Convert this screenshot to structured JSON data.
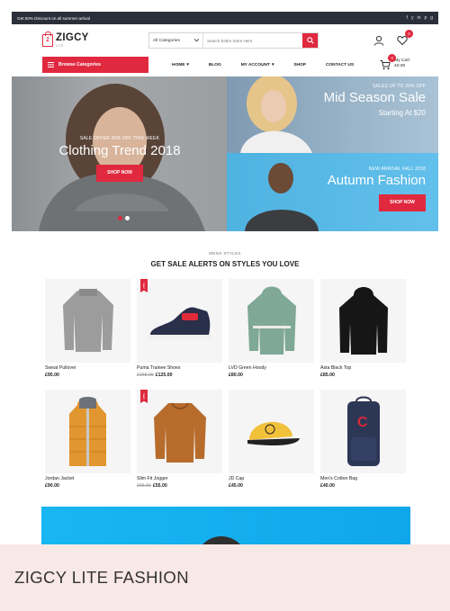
{
  "topbar": {
    "promo": "Get 50% Discount on all summer arrival",
    "social": [
      "f",
      "y",
      "in",
      "p",
      "g"
    ]
  },
  "header": {
    "logo_text": "ZIGCY",
    "logo_sub": "LITE",
    "search_category": "All Categories",
    "search_placeholder": "Search Entire Store Here",
    "wishlist_count": "0"
  },
  "nav": {
    "browse": "Browse Categories",
    "menu": [
      "HOME",
      "BLOG",
      "MY ACCOUNT",
      "SHOP",
      "CONTACT US"
    ],
    "cart_label": "My Cart",
    "cart_total": "£0.00",
    "cart_count": "0"
  },
  "hero": {
    "left": {
      "offer": "SALE OFFER 20% OFF THIS WEEK",
      "title": "Clothing Trend 2018",
      "button": "SHOP NOW"
    },
    "top_right": {
      "offer": "SALES UP TO 25% OFF",
      "title": "Mid Season Sale",
      "sub": "Starting At $20"
    },
    "bottom_right": {
      "offer": "NEW ARRIVAL FALL 2018",
      "title": "Autumn Fashion",
      "button": "SHOP NOW"
    }
  },
  "section": {
    "sub": "MENS STYLES",
    "title": "GET SALE ALERTS ON STYLES YOU LOVE"
  },
  "products": [
    {
      "name": "Sweat Pullover",
      "price": "£95.00",
      "old_price": "",
      "sale": false
    },
    {
      "name": "Puma Trainee Shoes",
      "price": "£125.00",
      "old_price": "£165.00",
      "sale": true
    },
    {
      "name": "LVD Green Hoody",
      "price": "£80.00",
      "old_price": "",
      "sale": false
    },
    {
      "name": "Asta Black Top",
      "price": "£85.00",
      "old_price": "",
      "sale": false
    },
    {
      "name": "Jordan Jacket",
      "price": "£90.00",
      "old_price": "",
      "sale": false
    },
    {
      "name": "Slim Fit Jogger",
      "price": "£55.00",
      "old_price": "£65.00",
      "sale": true
    },
    {
      "name": "JD Cap",
      "price": "£45.00",
      "old_price": "",
      "sale": false
    },
    {
      "name": "Men's Cotton Bag",
      "price": "£40.00",
      "old_price": "",
      "sale": false
    }
  ],
  "sale_tag": "Sale!",
  "caption": "ZIGCY LITE FASHION",
  "colors": {
    "accent": "#e0293f",
    "topbar": "#2b2f3a",
    "caption_bg": "#f8e8e6"
  }
}
